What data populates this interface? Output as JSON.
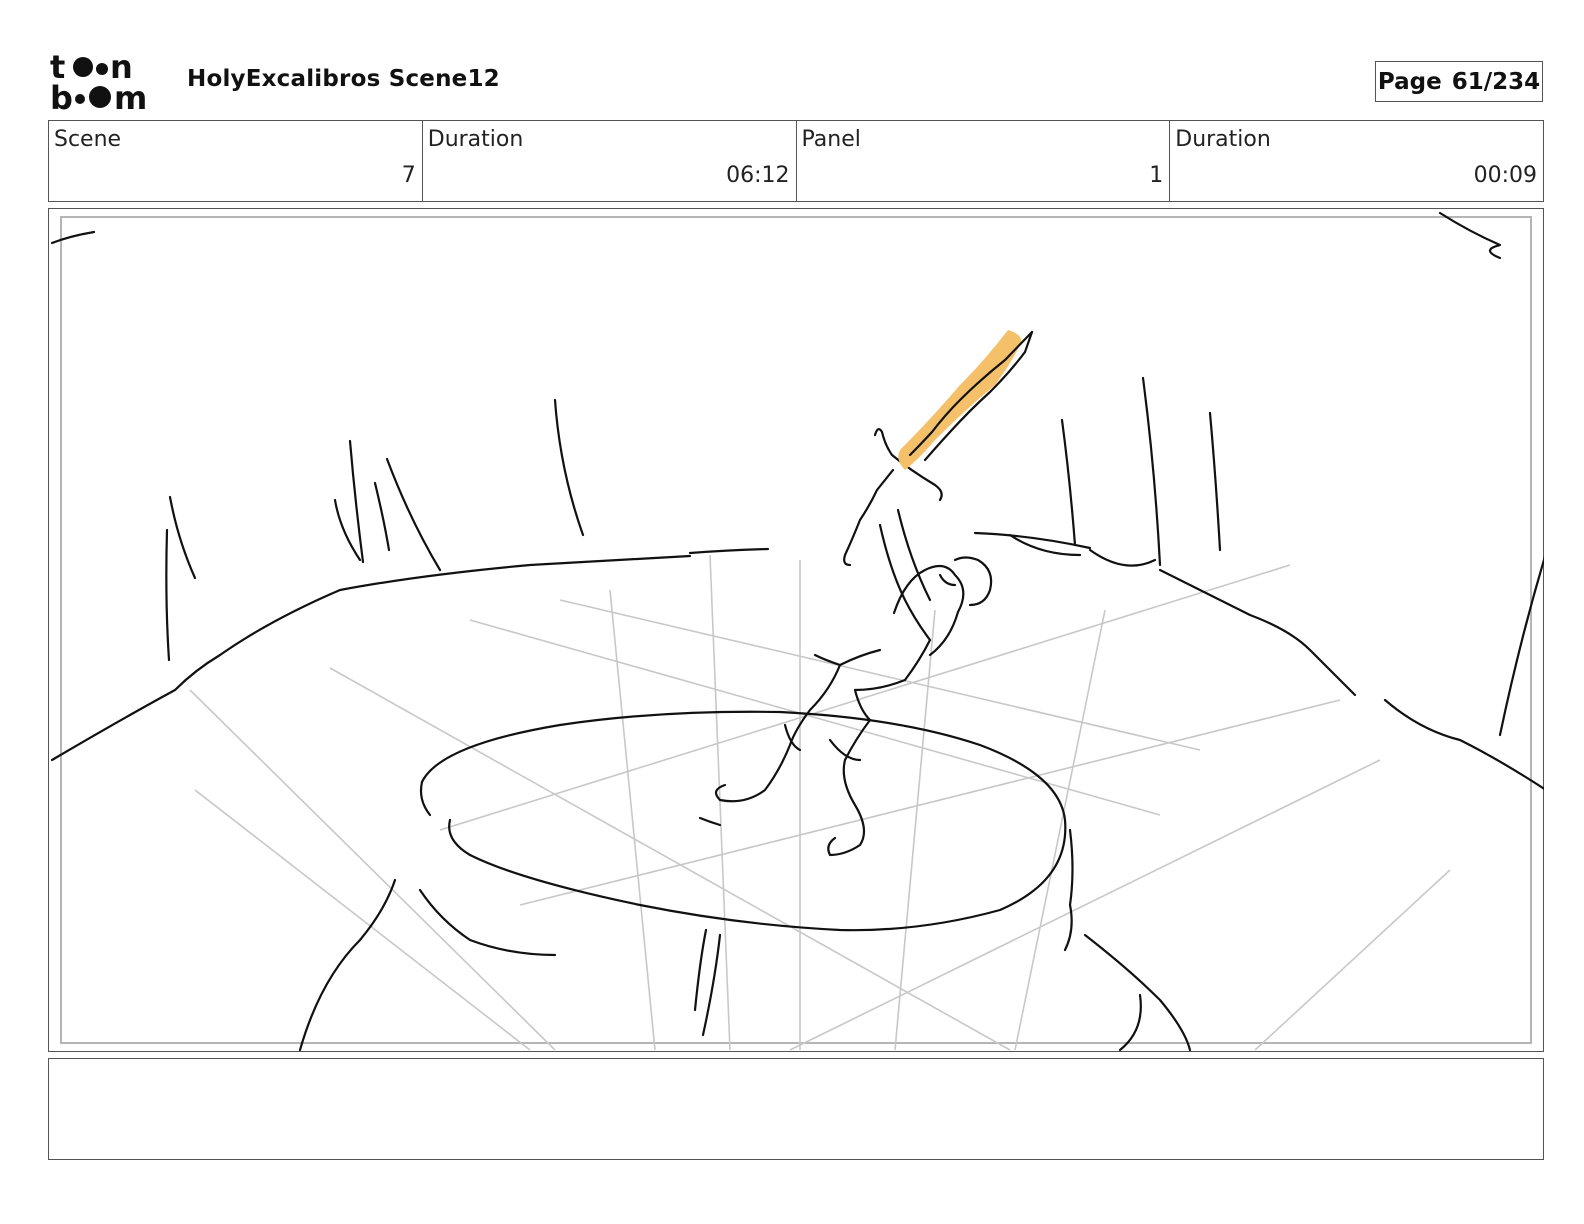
{
  "header": {
    "logo_text_top": "toon",
    "logo_text_bottom": "boom",
    "project_title": "HolyExcalibros Scene12",
    "page_label": "Page",
    "page_number": "61/234"
  },
  "info": {
    "scene_label": "Scene",
    "scene_value": "7",
    "scene_duration_label": "Duration",
    "scene_duration_value": "06:12",
    "panel_label": "Panel",
    "panel_value": "1",
    "panel_duration_label": "Duration",
    "panel_duration_value": "00:09"
  },
  "panel": {
    "sketch_line_color": "#111111",
    "guide_line_color": "#c8c8c8",
    "sword_color": "#f5c06a"
  },
  "notes": {
    "text": ""
  }
}
